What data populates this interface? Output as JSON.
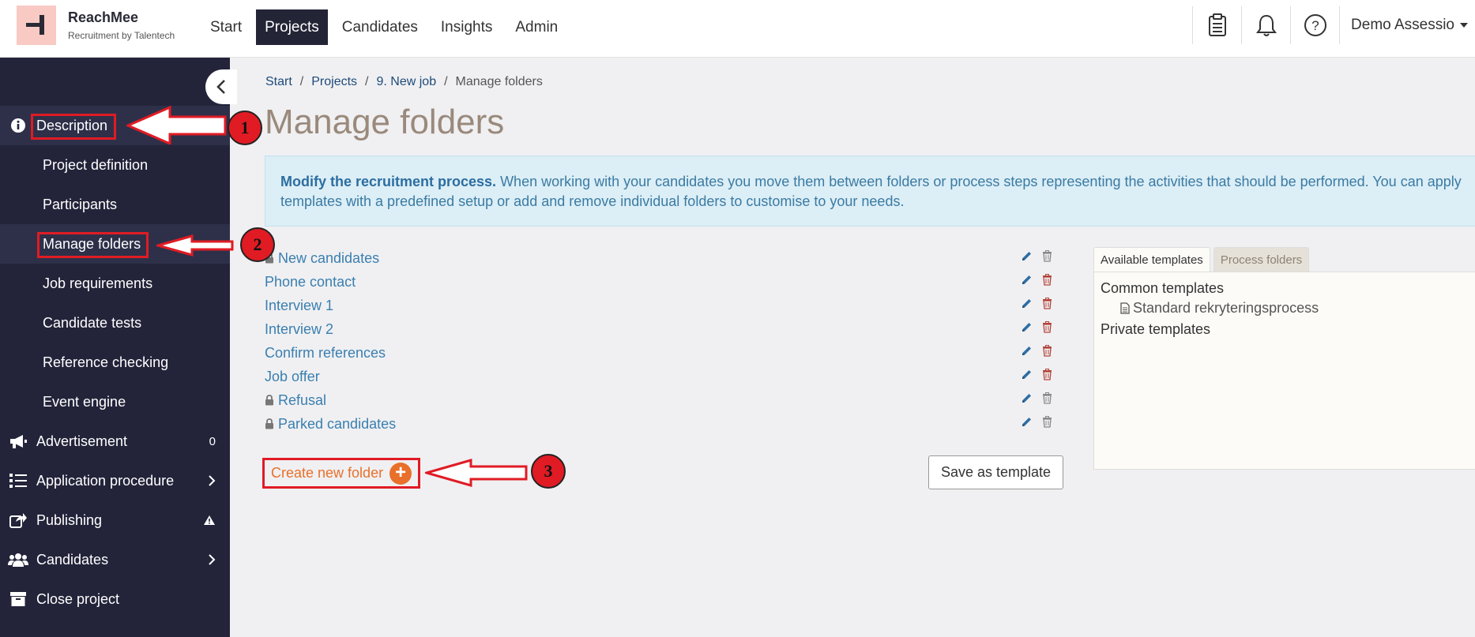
{
  "brand": {
    "name": "ReachMee",
    "subtitle": "Recruitment by Talentech"
  },
  "nav": [
    {
      "label": "Start",
      "active": false
    },
    {
      "label": "Projects",
      "active": true
    },
    {
      "label": "Candidates",
      "active": false
    },
    {
      "label": "Insights",
      "active": false
    },
    {
      "label": "Admin",
      "active": false
    }
  ],
  "topIcons": [
    "clipboard-icon",
    "bell-icon",
    "help-icon"
  ],
  "user": {
    "name": "Demo Assessio"
  },
  "sidebar": {
    "description": "Description",
    "subitems": [
      "Project definition",
      "Participants",
      "Manage folders",
      "Job requirements",
      "Candidate tests",
      "Reference checking",
      "Event engine"
    ],
    "advertisement": "Advertisement",
    "advertisementCount": "0",
    "applicationProcedure": "Application procedure",
    "publishing": "Publishing",
    "candidates": "Candidates",
    "closeProject": "Close project"
  },
  "breadcrumb": {
    "start": "Start",
    "projects": "Projects",
    "job": "9. New job",
    "current": "Manage folders"
  },
  "page": {
    "title": "Manage folders"
  },
  "info": {
    "bold": "Modify the recruitment process.",
    "text": " When working with your candidates you move them between folders or process steps representing the activities that should be performed. You can apply templates with a predefined setup or add and remove individual folders to customise to your needs."
  },
  "folders": [
    {
      "name": "New candidates",
      "locked": true,
      "deletable": false
    },
    {
      "name": "Phone contact",
      "locked": false,
      "deletable": true
    },
    {
      "name": "Interview 1",
      "locked": false,
      "deletable": true
    },
    {
      "name": "Interview 2",
      "locked": false,
      "deletable": true
    },
    {
      "name": "Confirm references",
      "locked": false,
      "deletable": true
    },
    {
      "name": "Job offer",
      "locked": false,
      "deletable": true
    },
    {
      "name": "Refusal",
      "locked": true,
      "deletable": false
    },
    {
      "name": "Parked candidates",
      "locked": true,
      "deletable": false
    }
  ],
  "actions": {
    "createFolder": "Create new folder",
    "saveTemplate": "Save as template"
  },
  "templates": {
    "tabs": [
      "Available templates",
      "Process folders"
    ],
    "commonHeading": "Common templates",
    "commonItem": "Standard rekryteringsprocess",
    "privateHeading": "Private templates"
  },
  "annotations": [
    "1",
    "2",
    "3"
  ],
  "colors": {
    "sidebarBg": "#23243a",
    "annotationRed": "#e01b24",
    "link": "#3a7fb0",
    "accentOrange": "#e8702a"
  }
}
